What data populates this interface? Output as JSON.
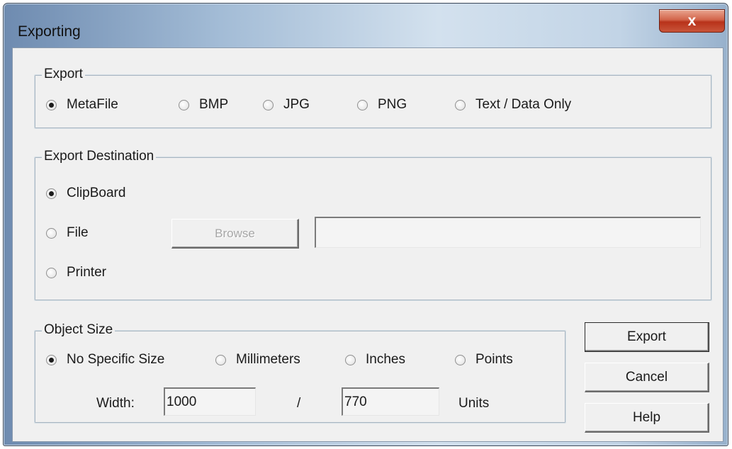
{
  "window": {
    "title": "Exporting",
    "close_label": "x"
  },
  "export_group": {
    "legend": "Export",
    "options": [
      {
        "label": "MetaFile",
        "checked": true
      },
      {
        "label": "BMP",
        "checked": false
      },
      {
        "label": "JPG",
        "checked": false
      },
      {
        "label": "PNG",
        "checked": false
      },
      {
        "label": "Text / Data Only",
        "checked": false
      }
    ]
  },
  "destination_group": {
    "legend": "Export Destination",
    "options": [
      {
        "label": "ClipBoard",
        "checked": true
      },
      {
        "label": "File",
        "checked": false
      },
      {
        "label": "Printer",
        "checked": false
      }
    ],
    "browse_label": "Browse",
    "file_path": ""
  },
  "size_group": {
    "legend": "Object Size",
    "options": [
      {
        "label": "No Specific Size",
        "checked": true
      },
      {
        "label": "Millimeters",
        "checked": false
      },
      {
        "label": "Inches",
        "checked": false
      },
      {
        "label": "Points",
        "checked": false
      }
    ],
    "width_label": "Width:",
    "width_value": "1000",
    "separator": "/",
    "height_value": "770",
    "units_label": "Units"
  },
  "buttons": {
    "export": "Export",
    "cancel": "Cancel",
    "help": "Help"
  }
}
